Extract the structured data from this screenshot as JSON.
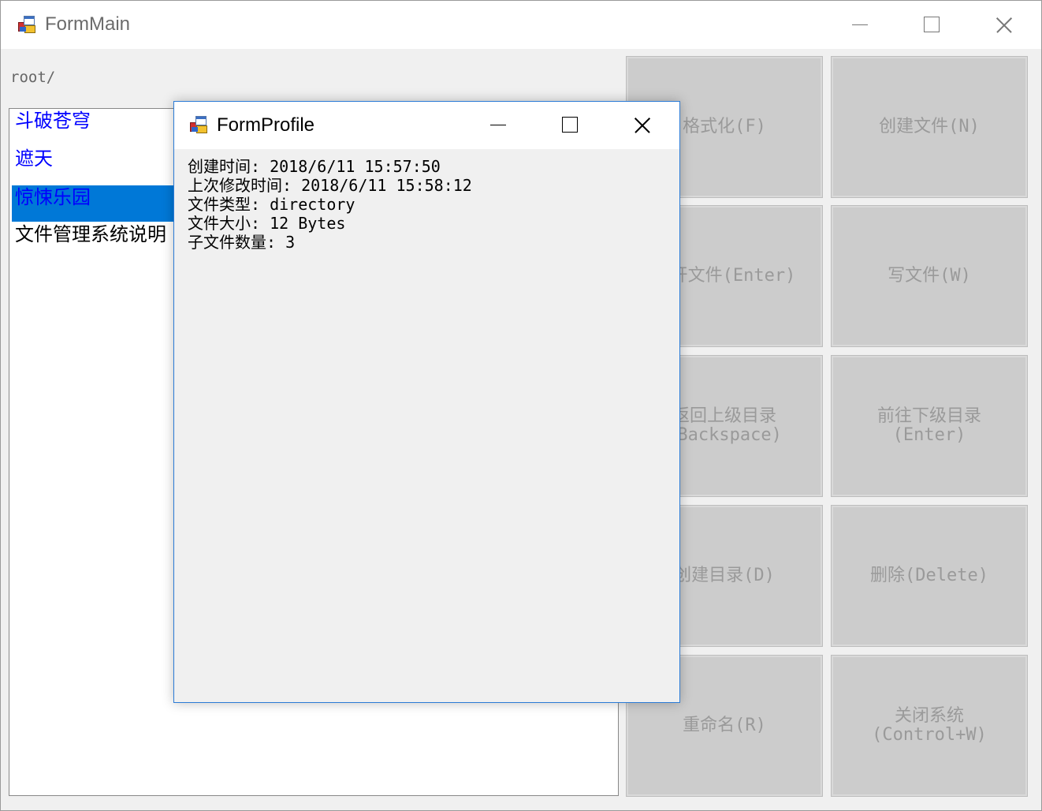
{
  "main_window": {
    "title": "FormMain",
    "path": "root/",
    "files": [
      {
        "name": "斗破苍穹",
        "color": "#0000ff",
        "selected": false
      },
      {
        "name": "遮天",
        "color": "#0000ff",
        "selected": false
      },
      {
        "name": "惊悚乐园",
        "color": "#0000ff",
        "selected": true
      },
      {
        "name": "文件管理系统说明",
        "color": "#000000",
        "selected": false
      }
    ],
    "buttons": [
      {
        "label": "格式化(F)",
        "sub": ""
      },
      {
        "label": "创建文件(N)",
        "sub": ""
      },
      {
        "label": "打开文件(Enter)",
        "sub": ""
      },
      {
        "label": "写文件(W)",
        "sub": ""
      },
      {
        "label": "返回上级目录",
        "sub": "(Backspace)"
      },
      {
        "label": "前往下级目录",
        "sub": "(Enter)"
      },
      {
        "label": "创建目录(D)",
        "sub": ""
      },
      {
        "label": "删除(Delete)",
        "sub": ""
      },
      {
        "label": "重命名(R)",
        "sub": ""
      },
      {
        "label": "关闭系统",
        "sub": "(Control+W)"
      }
    ]
  },
  "profile_window": {
    "title": "FormProfile",
    "info": [
      "创建时间: 2018/6/11 15:57:50",
      "上次修改时间: 2018/6/11 15:58:12",
      "文件类型: directory",
      "文件大小: 12 Bytes",
      "子文件数量: 3"
    ]
  },
  "icons": {
    "app_icon": "windows-forms-app-icon",
    "minimize": "minimize-icon",
    "maximize": "maximize-icon",
    "close": "close-icon"
  },
  "colors": {
    "selection": "#0078d7",
    "dialog_border": "#2b7bd6",
    "button_bg": "#cccccc",
    "button_text": "#9a9a9a"
  }
}
